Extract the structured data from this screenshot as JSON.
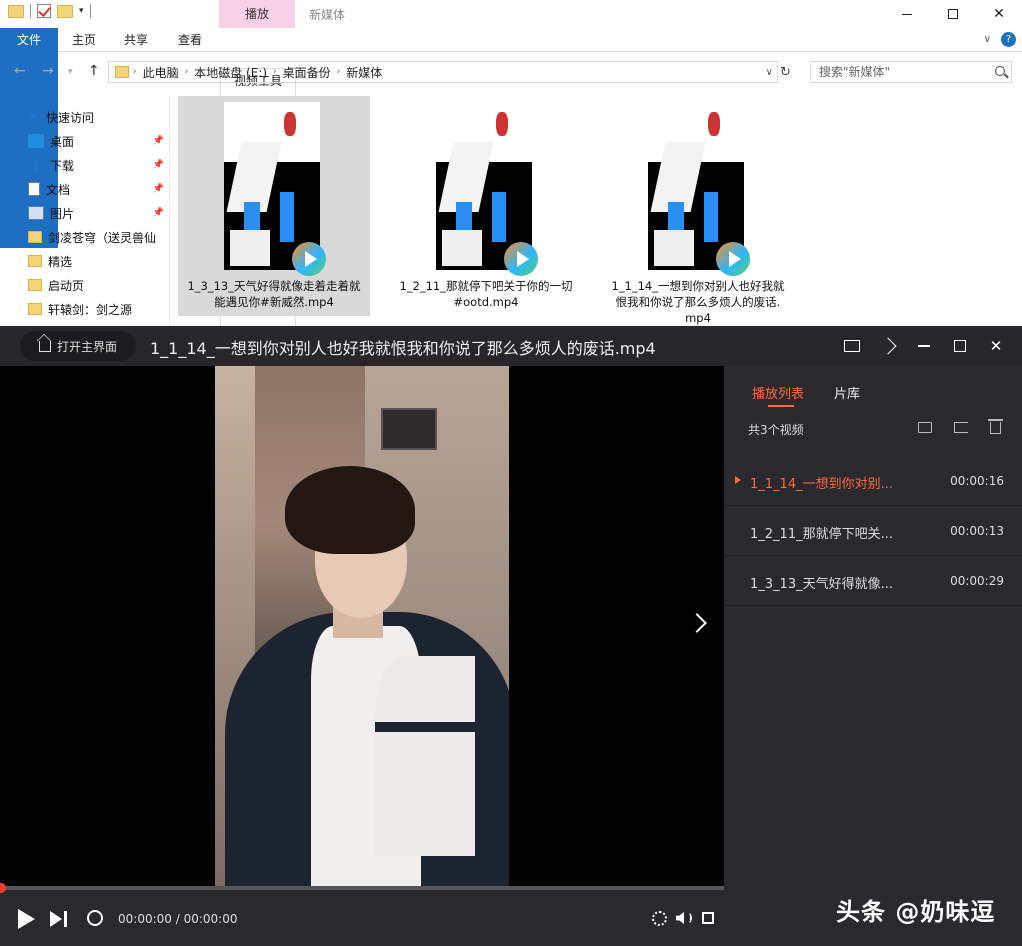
{
  "explorer": {
    "title": "新媒体",
    "context_tab": "播放",
    "tabs": {
      "file": "文件",
      "home": "主页",
      "share": "共享",
      "view": "查看",
      "video_tools": "视频工具"
    },
    "breadcrumb": [
      "此电脑",
      "本地磁盘 (E:)",
      "桌面备份",
      "新媒体"
    ],
    "search_placeholder": "搜索\"新媒体\"",
    "nav": {
      "quick_access": "快速访问",
      "items": [
        {
          "label": "桌面",
          "icon": "desktop-icon",
          "pinned": true
        },
        {
          "label": "下载",
          "icon": "download-icon",
          "pinned": true
        },
        {
          "label": "文档",
          "icon": "document-icon",
          "pinned": true
        },
        {
          "label": "图片",
          "icon": "pictures-icon",
          "pinned": true
        },
        {
          "label": "剑凌苍穹（送灵兽仙",
          "icon": "folder-icon",
          "pinned": false
        },
        {
          "label": "精选",
          "icon": "folder-icon",
          "pinned": false
        },
        {
          "label": "启动页",
          "icon": "folder-icon",
          "pinned": false
        },
        {
          "label": "轩辕剑：剑之源",
          "icon": "folder-icon",
          "pinned": false
        }
      ]
    },
    "files": [
      {
        "line1": "1_3_13_天气好得就像走着走着就",
        "line2": "能遇见你#新威然.mp4",
        "line3": "",
        "selected": true
      },
      {
        "line1": "1_2_11_那就停下吧关于你的一切",
        "line2": "#ootd.mp4",
        "line3": "",
        "selected": false
      },
      {
        "line1": "1_1_14_一想到你对别人也好我就",
        "line2": "恨我和你说了那么多烦人的废话.",
        "line3": "mp4",
        "selected": false
      }
    ]
  },
  "player": {
    "home_button": "打开主界面",
    "title": "1_1_14_一想到你对别人也好我就恨我和你说了那么多烦人的废话.mp4",
    "tabs": {
      "playlist": "播放列表",
      "library": "片库"
    },
    "count": "共3个视频",
    "playlist": [
      {
        "name": "1_1_14_一想到你对别...",
        "duration": "00:00:16",
        "playing": true
      },
      {
        "name": "1_2_11_那就停下吧关...",
        "duration": "00:00:13",
        "playing": false
      },
      {
        "name": "1_3_13_天气好得就像...",
        "duration": "00:00:29",
        "playing": false
      }
    ],
    "time": "00:00:00 / 00:00:00",
    "progress": 0,
    "accent": "#ff6a3a"
  },
  "watermark": "头条 @奶味逗"
}
